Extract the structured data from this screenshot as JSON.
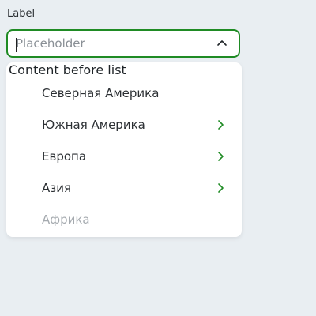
{
  "field": {
    "label": "Label",
    "placeholder": "Placeholder",
    "value": ""
  },
  "dropdown": {
    "header_text": "Content before list",
    "options": [
      {
        "label": "Северная Америка",
        "has_submenu": false,
        "disabled": false
      },
      {
        "label": "Южная Америка",
        "has_submenu": true,
        "disabled": false
      },
      {
        "label": "Европа",
        "has_submenu": true,
        "disabled": false
      },
      {
        "label": "Азия",
        "has_submenu": true,
        "disabled": false
      },
      {
        "label": "Африка",
        "has_submenu": false,
        "disabled": true
      }
    ]
  },
  "colors": {
    "accent": "#1f8b24",
    "background": "#e9eef2",
    "disabled_text": "#a5aaaf"
  },
  "icons": {
    "toggle": "chevron-up-icon",
    "submenu": "chevron-right-icon"
  }
}
